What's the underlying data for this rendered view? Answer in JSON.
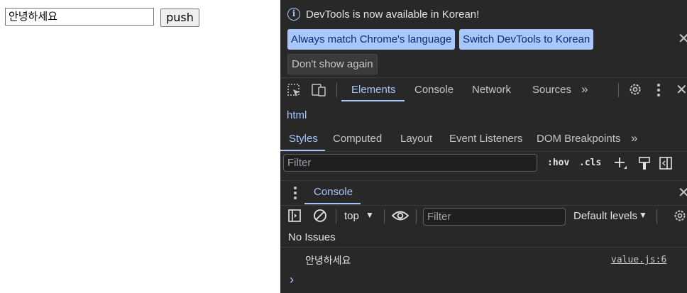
{
  "page": {
    "input_value": "안녕하세요",
    "push_label": "push"
  },
  "devtools": {
    "banner": {
      "message": "DevTools is now available in Korean!",
      "btn_match": "Always match Chrome's language",
      "btn_switch": "Switch DevTools to Korean",
      "btn_dismiss": "Don't show again"
    },
    "tabs": [
      "Elements",
      "Console",
      "Network",
      "Sources"
    ],
    "active_tab": "Elements",
    "breadcrumb": "html",
    "subtabs": [
      "Styles",
      "Computed",
      "Layout",
      "Event Listeners",
      "DOM Breakpoints"
    ],
    "styles_filter_placeholder": "Filter",
    "hov_label": ":hov",
    "cls_label": ".cls",
    "drawer_tab": "Console",
    "console": {
      "context": "top",
      "filter_placeholder": "Filter",
      "levels": "Default levels",
      "issues": "No Issues",
      "log_message": "안녕하세요",
      "log_source": "value.js:6"
    },
    "colors": {
      "accent": "#a8c7fa",
      "background": "#282828",
      "text": "#e3e3e3"
    }
  }
}
